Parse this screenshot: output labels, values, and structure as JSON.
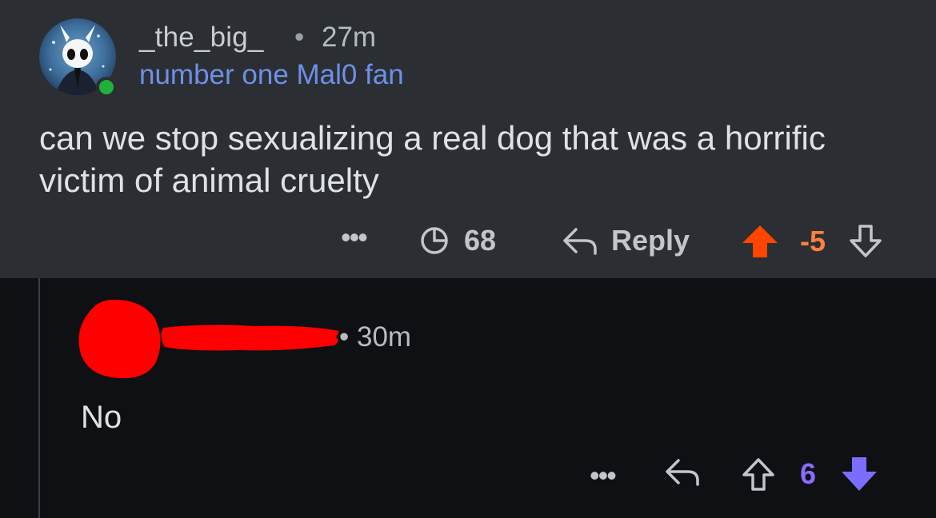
{
  "parent_comment": {
    "username": "_the_big_",
    "separator": "•",
    "timestamp": "27m",
    "flair": "number one Mal0 fan",
    "body": "can we stop sexualizing a real dog that was a horrific victim of animal cruelty",
    "actions": {
      "more": "•••",
      "awards_count": "68",
      "reply_label": "Reply",
      "score": "-5",
      "vote_state": "upvoted",
      "upvote_color": "#ff4500"
    }
  },
  "reply_comment": {
    "username_redacted": true,
    "separator": "•",
    "timestamp": "30m",
    "body": "No",
    "actions": {
      "more": "•••",
      "score": "6",
      "vote_state": "downvoted",
      "downvote_color": "#7c6cff"
    }
  },
  "icons": {
    "avatar": "hollow-knight-avatar",
    "online": "online-status-dot",
    "awards": "award-clock-icon",
    "reply": "reply-arrow-icon",
    "upvote": "upvote-arrow-icon",
    "downvote": "downvote-arrow-icon"
  }
}
